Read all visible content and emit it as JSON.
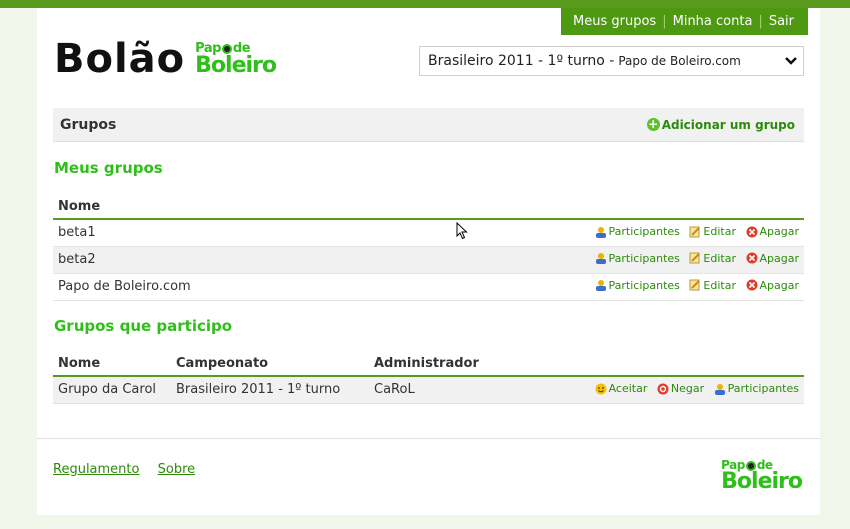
{
  "header": {
    "nav": [
      "Meus grupos",
      "Minha conta",
      "Sair"
    ],
    "logo_text": "Bolão",
    "brand_line1": "Papo de",
    "brand_line2": "Boleiro",
    "select_main": "Brasileiro 2011 - 1º turno -",
    "select_small": "Papo de Boleiro.com"
  },
  "groups_bar": {
    "title": "Grupos",
    "add_label": "Adicionar um grupo"
  },
  "my_groups": {
    "heading": "Meus grupos",
    "col_name": "Nome",
    "rows": [
      {
        "name": "beta1"
      },
      {
        "name": "beta2"
      },
      {
        "name": "Papo de Boleiro.com"
      }
    ],
    "actions": {
      "participants": "Participantes",
      "edit": "Editar",
      "delete": "Apagar"
    }
  },
  "participating": {
    "heading": "Grupos que participo",
    "cols": [
      "Nome",
      "Campeonato",
      "Administrador"
    ],
    "rows": [
      {
        "name": "Grupo da Carol",
        "championship": "Brasileiro 2011 - 1º turno",
        "admin": "CaRoL"
      }
    ],
    "actions": {
      "accept": "Aceitar",
      "deny": "Negar",
      "participants": "Participantes"
    }
  },
  "footer": {
    "links": [
      "Regulamento",
      "Sobre"
    ]
  },
  "colors": {
    "brand_green": "#2fbf1a",
    "nav_green": "#4d9a12",
    "link_green": "#2d8a0c"
  }
}
